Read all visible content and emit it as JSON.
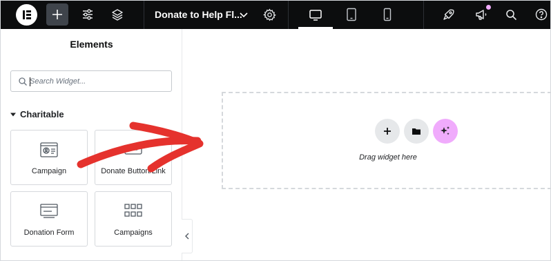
{
  "topbar": {
    "document_title": "Donate to Help Fl...",
    "icons": {
      "logo": "elementor-logo",
      "add": "plus-icon",
      "site_settings": "sliders-icon",
      "structure": "layers-icon",
      "title_menu": "chevron-down-icon",
      "page_settings": "gear-icon",
      "desktop": "desktop-icon",
      "tablet": "tablet-icon",
      "mobile": "mobile-icon",
      "publish_checklist": "rocket-icon",
      "whats_new": "megaphone-icon",
      "finder": "search-icon",
      "help": "help-icon"
    },
    "notification_color": "#f0abfc"
  },
  "panel": {
    "title": "Elements",
    "search": {
      "placeholder": "Search Widget...",
      "value": ""
    },
    "category": "Charitable",
    "widgets": [
      {
        "label": "Campaign",
        "icon": "campaign-icon"
      },
      {
        "label": "Donate Button/Link",
        "icon": "donate-button-icon"
      },
      {
        "label": "Donation Form",
        "icon": "donation-form-icon"
      },
      {
        "label": "Campaigns",
        "icon": "campaigns-grid-icon"
      }
    ]
  },
  "canvas": {
    "dropzone_text": "Drag widget here",
    "buttons": [
      "plus-icon",
      "folder-icon",
      "sparkles-icon"
    ],
    "ai_color": "#f0abfc"
  },
  "annotation": {
    "color": "#e5322d",
    "shape": "arrow-right"
  }
}
